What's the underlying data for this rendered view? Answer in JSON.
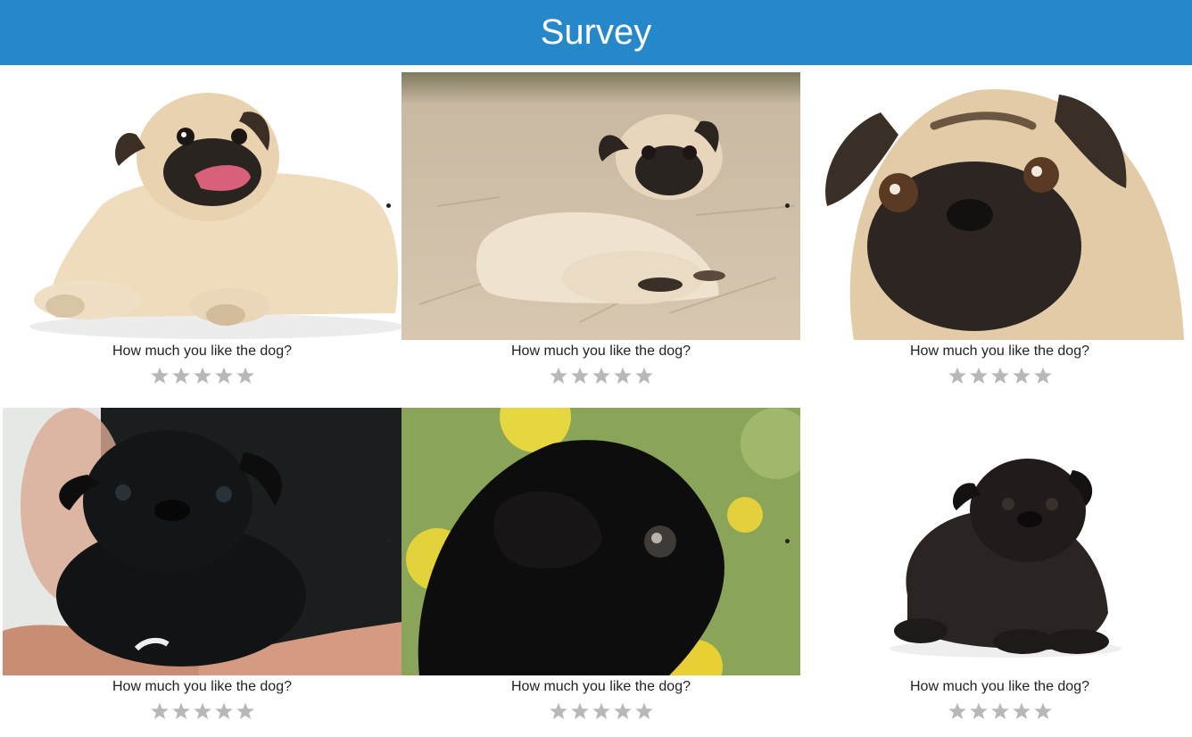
{
  "header": {
    "title": "Survey"
  },
  "rating": {
    "max": 5,
    "star_color": "#b8b8b8"
  },
  "cards": [
    {
      "question": "How much you like the dog?",
      "image_name": "pug-fawn-tongue-out"
    },
    {
      "question": "How much you like the dog?",
      "image_name": "pug-fawn-on-sand"
    },
    {
      "question": "How much you like the dog?",
      "image_name": "pug-fawn-face-closeup"
    },
    {
      "question": "How much you like the dog?",
      "image_name": "pug-black-puppy-in-hands"
    },
    {
      "question": "How much you like the dog?",
      "image_name": "pug-black-puppy-profile"
    },
    {
      "question": "How much you like the dog?",
      "image_name": "pug-black-lying"
    }
  ]
}
